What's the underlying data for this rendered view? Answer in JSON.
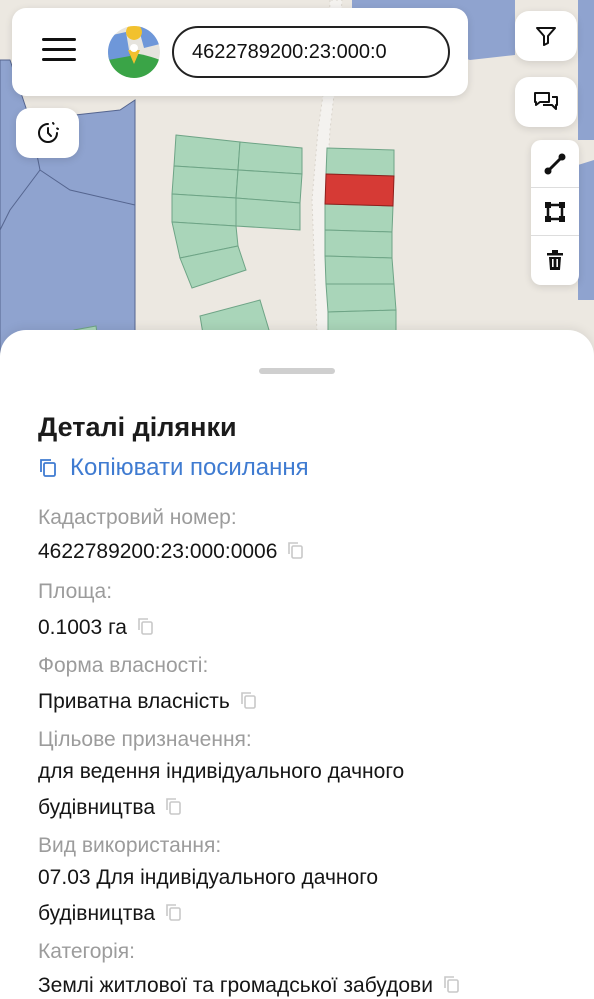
{
  "search": {
    "value": "4622789200:23:000:0"
  },
  "details": {
    "title": "Деталі ділянки",
    "copy_link": "Копіювати посилання",
    "cadastral_label": "Кадастровий номер:",
    "cadastral_value": "4622789200:23:000:0006",
    "area_label": "Площа:",
    "area_value": "0.1003 га",
    "ownership_label": "Форма власності:",
    "ownership_value": "Приватна власність",
    "purpose_label": "Цільове призначення:",
    "purpose_value_1": "для ведення індивідуального дачного",
    "purpose_value_2": "будівництва",
    "usage_label": "Вид використання:",
    "usage_value_1": "07.03 Для індивідуального дачного",
    "usage_value_2": "будівництва",
    "category_label": "Категорія:",
    "category_value": "Землі житлової та громадської забудови"
  },
  "colors": {
    "parcel": "#a9d5b9",
    "selected_parcel": "#d63a35",
    "water": "#8fa3cf",
    "link": "#3f7bd1"
  },
  "icons": [
    "menu-icon",
    "map-logo-icon",
    "filter-icon",
    "chat-icon",
    "history-icon",
    "line-tool-icon",
    "polygon-tool-icon",
    "trash-icon",
    "copy-icon"
  ]
}
